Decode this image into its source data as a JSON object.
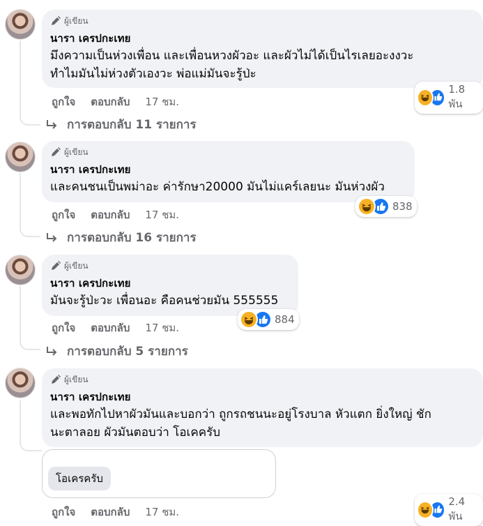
{
  "comments": [
    {
      "badge": "ผู้เขียน",
      "author": "นารา เครปกะเทย",
      "lines": [
        "มึงความเป็นห่วงเพื่อน และเพื่อนหวงผัวอะ และผัวไม่ได้เป็นไรเลยอะงงวะ",
        "ทำไมมันไม่ห่วงตัวเองวะ พ่อแม่มันจะรู้ป่ะ"
      ],
      "like": "ถูกใจ",
      "reply": "ตอบกลับ",
      "time": "17 ชม.",
      "reaction_count": "1.8 พัน",
      "replies_label": "การตอบกลับ 11 รายการ"
    },
    {
      "badge": "ผู้เขียน",
      "author": "นารา เครปกะเทย",
      "lines": [
        "และคนชนเป็นพม่าอะ ค่ารักษา20000 มันไม่แคร์เลยนะ มันห่วงผัว"
      ],
      "like": "ถูกใจ",
      "reply": "ตอบกลับ",
      "time": "17 ชม.",
      "reaction_count": "838",
      "replies_label": "การตอบกลับ 16 รายการ"
    },
    {
      "badge": "ผู้เขียน",
      "author": "นารา เครปกะเทย",
      "lines": [
        "มันจะรู้ป่ะวะ เพื่อนอะ คือคนช่วยมัน 555555"
      ],
      "like": "ถูกใจ",
      "reply": "ตอบกลับ",
      "time": "17 ชม.",
      "reaction_count": "884",
      "replies_label": "การตอบกลับ 5 รายการ"
    },
    {
      "badge": "ผู้เขียน",
      "author": "นารา เครปกะเทย",
      "lines": [
        "และพอทักไปหาผัวมันและบอกว่า ถูกรถชนนะอยู่โรงบาล หัวแตก ยิ่งใหญ่ ชัก",
        "นะตาลอย ผัวมันตอบว่า โอเคครับ"
      ],
      "like": "ถูกใจ",
      "reply": "ตอบกลับ",
      "time": "17 ชม.",
      "reaction_count": "2.4 พัน",
      "quoted_reply": "โอเครครับ"
    }
  ],
  "icons": {
    "badge": "pencil-icon",
    "reply_thread": "reply-arrow-icon",
    "reaction_1": "haha-icon",
    "reaction_2": "like-icon"
  },
  "colors": {
    "bubble": "#f0f2f5",
    "secondary_text": "#65676b",
    "like_blue": "#1877f2",
    "haha_yellow": "#f7b125"
  }
}
